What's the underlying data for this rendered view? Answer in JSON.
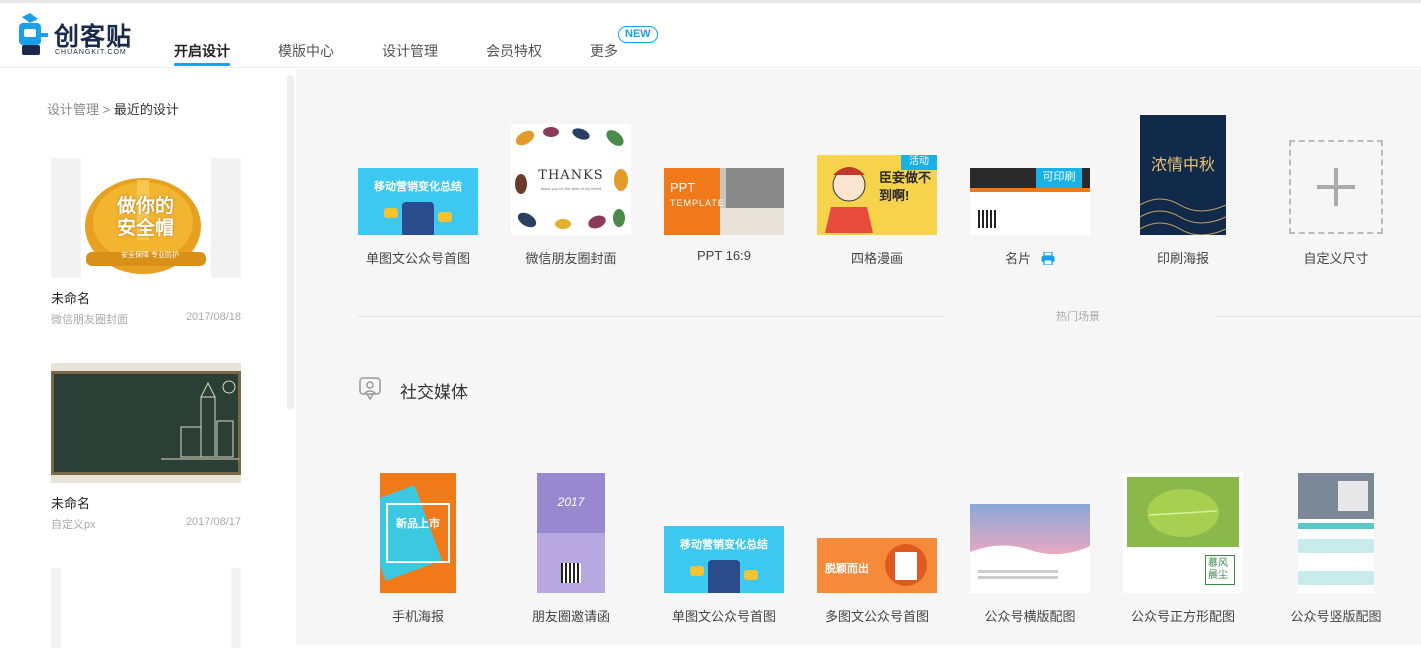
{
  "logo": {
    "text": "创客贴",
    "sub": "CHUANGKIT.COM"
  },
  "nav": {
    "items": [
      "开启设计",
      "模版中心",
      "设计管理",
      "会员特权",
      "更多"
    ],
    "badge": "NEW"
  },
  "sidebar": {
    "breadcrumb_parent": "设计管理",
    "breadcrumb_sep": ">",
    "breadcrumb_current": "最近的设计",
    "designs": [
      {
        "name": "未命名",
        "type": "微信朋友圈封面",
        "date": "2017/08/18",
        "thumb_text_1": "做你的",
        "thumb_text_2": "安全帽",
        "thumb_text_3": "安全保障 专业防护"
      },
      {
        "name": "未命名",
        "type": "自定义px",
        "date": "2017/08/17"
      }
    ]
  },
  "templates": [
    {
      "label": "单图文公众号首图",
      "thumb_text": "移动营销变化总结"
    },
    {
      "label": "微信朋友圈封面",
      "thumb_text": "THANKS",
      "thumb_sub": "thank you for the time of my friend"
    },
    {
      "label": "PPT 16:9",
      "thumb_text": "PPT",
      "thumb_sub": "TEMPLATE"
    },
    {
      "label": "四格漫画",
      "thumb_text": "臣妾做不到啊!",
      "badge": "活动"
    },
    {
      "label": "名片",
      "badge": "可印刷"
    },
    {
      "label": "印刷海报",
      "thumb_text": "浓情中秋"
    },
    {
      "label": "自定义尺寸"
    }
  ],
  "hot_scene": "热门场景",
  "social": {
    "title": "社交媒体",
    "items": [
      {
        "label": "手机海报",
        "thumb_text": "新品上市"
      },
      {
        "label": "朋友圈邀请函",
        "thumb_text": "2017"
      },
      {
        "label": "单图文公众号首图",
        "thumb_text": "移动营销变化总结"
      },
      {
        "label": "多图文公众号首图",
        "thumb_text": "脱颖而出"
      },
      {
        "label": "公众号横版配图"
      },
      {
        "label": "公众号正方形配图",
        "thumb_text": "慕风晨尘"
      },
      {
        "label": "公众号竖版配图"
      }
    ]
  },
  "colors": {
    "accent": "#1aa0e8",
    "main_bg": "#f6f6f6"
  }
}
